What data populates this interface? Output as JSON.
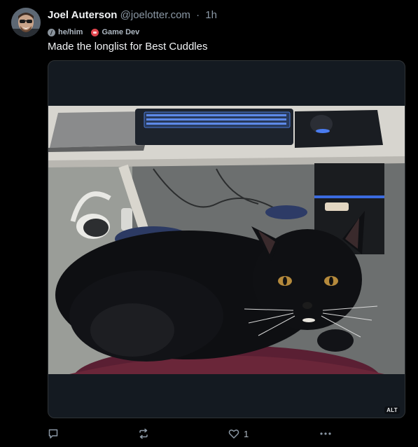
{
  "post": {
    "author": {
      "display_name": "Joel Auterson",
      "handle": "@joelotter.com",
      "avatar_icon": "user-avatar"
    },
    "separator": "·",
    "time": "1h",
    "badges": [
      {
        "label": "he/him",
        "icon": "pronoun-icon",
        "color": "#8a939c"
      },
      {
        "label": "Game Dev",
        "icon": "game-controller-icon",
        "color": "#e0454d"
      }
    ],
    "text": "Made the longlist for Best Cuddles",
    "media": {
      "alt_label": "ALT",
      "frame_color": "#141a21"
    },
    "actions": {
      "reply_icon": "reply-icon",
      "repost_icon": "repost-icon",
      "like_icon": "heart-icon",
      "like_count": "1",
      "more_icon": "ellipsis-icon"
    }
  },
  "colors": {
    "background": "#000000",
    "text_primary": "#f1f3f5",
    "text_secondary": "#8b98a5",
    "border": "#2f3336"
  }
}
